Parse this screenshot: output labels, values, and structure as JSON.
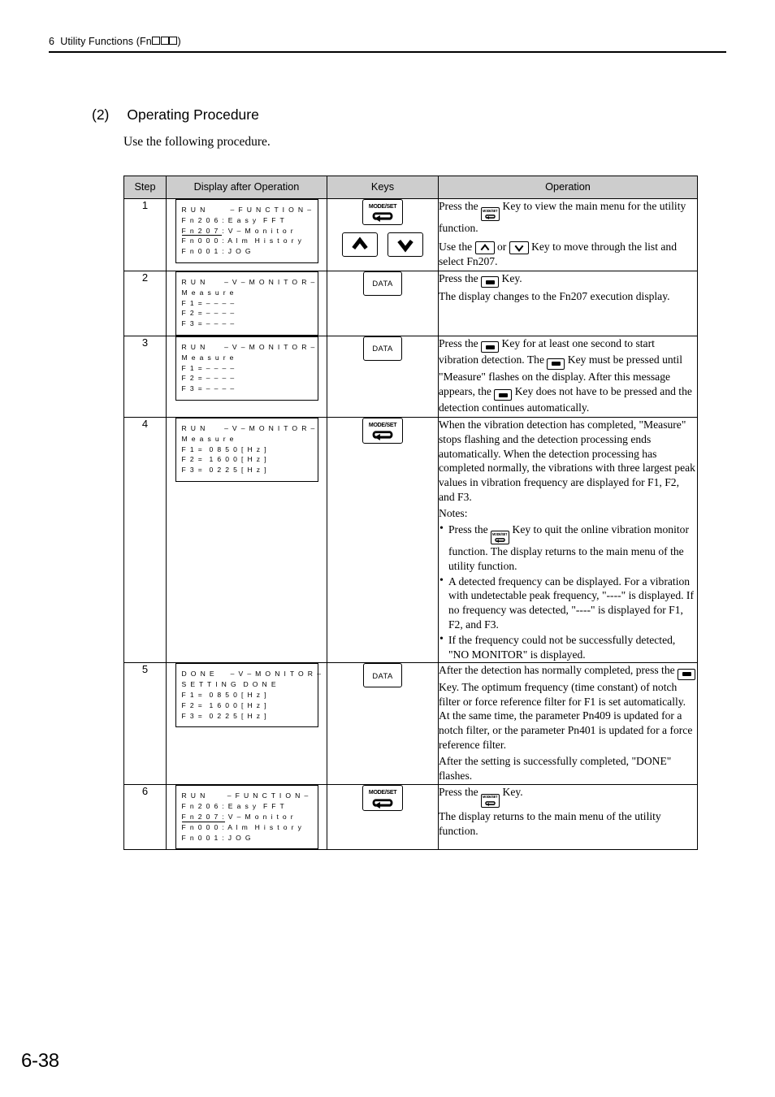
{
  "header": {
    "chapter_number": "6",
    "chapter_title_prefix": "Utility Functions (Fn",
    "chapter_title_suffix": ")",
    "placeholder_box_count": 3
  },
  "section": {
    "number": "(2)",
    "title": "Operating Procedure",
    "intro": "Use the following procedure."
  },
  "table": {
    "headers": {
      "step": "Step",
      "display": "Display after Operation",
      "keys": "Keys",
      "operation": "Operation"
    },
    "rows": [
      {
        "step": "1",
        "display_lines": [
          "R U N        – F U N C T I O N –",
          "F n 2 0 6 : E a s y  F F T",
          "F n 2 0 7 : V – M o n i t o r",
          "F n 0 0 0 : A l m  H i s t o r y",
          "F n 0 0 1 : J O G"
        ],
        "underlined_line_index": 2,
        "underlined_text": "F n 2 0 7 ",
        "keys": [
          "modeset",
          "up",
          "down"
        ],
        "operation_paragraphs": [
          {
            "parts": [
              {
                "type": "text",
                "value": "Press the "
              },
              {
                "type": "icon",
                "value": "modeset-key-icon"
              },
              {
                "type": "text",
                "value": " Key to view the main menu for the utility function."
              }
            ]
          },
          {
            "parts": [
              {
                "type": "text",
                "value": "Use the "
              },
              {
                "type": "icon",
                "value": "up-arrow-key-icon"
              },
              {
                "type": "text",
                "value": " or "
              },
              {
                "type": "icon",
                "value": "down-arrow-key-icon"
              },
              {
                "type": "text",
                "value": " Key to move through the list and select Fn207."
              }
            ]
          }
        ]
      },
      {
        "step": "2",
        "display_lines": [
          "R U N      – V – M O N I T O R –",
          "M e a s u r e",
          "F 1 = – – – –",
          "F 2 = – – – –",
          "F 3 = – – – –"
        ],
        "keys": [
          "data"
        ],
        "operation_paragraphs": [
          {
            "parts": [
              {
                "type": "text",
                "value": "Press the "
              },
              {
                "type": "icon",
                "value": "data-key-icon"
              },
              {
                "type": "text",
                "value": " Key."
              }
            ]
          },
          {
            "parts": [
              {
                "type": "text",
                "value": "The display changes to the Fn207 execution display."
              }
            ]
          }
        ]
      },
      {
        "step": "3",
        "display_lines": [
          "R U N      – V – M O N I T O R –",
          "M e a s u r e",
          "F 1 = – – – –",
          "F 2 = – – – –",
          "F 3 = – – – –"
        ],
        "keys": [
          "data"
        ],
        "operation_paragraphs": [
          {
            "parts": [
              {
                "type": "text",
                "value": "Press the "
              },
              {
                "type": "icon",
                "value": "data-key-icon"
              },
              {
                "type": "text",
                "value": " Key for at least one second to start vibration detection. The "
              },
              {
                "type": "icon",
                "value": "data-key-icon"
              },
              {
                "type": "text",
                "value": " Key must be pressed until \"Measure\" flashes on the display. After this message appears, the "
              },
              {
                "type": "icon",
                "value": "data-key-icon"
              },
              {
                "type": "text",
                "value": " Key does not have to be pressed and the detection continues automatically."
              }
            ]
          }
        ]
      },
      {
        "step": "4",
        "display_lines": [
          "R U N      – V – M O N I T O R –",
          "M e a s u r e",
          "F 1 =  0 8 5 0 [ H z ]",
          "F 2 =  1 6 0 0 [ H z ]",
          "F 3 =  0 2 2 5 [ H z ]"
        ],
        "keys": [
          "modeset"
        ],
        "operation_paragraphs": [
          {
            "parts": [
              {
                "type": "text",
                "value": "When the vibration detection has completed, \"Measure\" stops flashing and the detection processing ends automatically. When the detection processing has completed normally, the vibrations with three largest peak values in vibration frequency are displayed for F1, F2, and F3."
              }
            ]
          },
          {
            "parts": [
              {
                "type": "text",
                "value": "Notes:"
              }
            ]
          }
        ],
        "notes": [
          {
            "parts": [
              {
                "type": "text",
                "value": "Press the "
              },
              {
                "type": "icon",
                "value": "modeset-key-icon"
              },
              {
                "type": "text",
                "value": " Key to quit the online vibration monitor function. The display returns to the main menu of the utility function."
              }
            ]
          },
          {
            "parts": [
              {
                "type": "text",
                "value": "A detected frequency can be displayed. For a vibration with undetectable peak frequency, \"----\" is displayed. If no frequency was detected, \"----\" is displayed for F1, F2, and F3."
              }
            ]
          },
          {
            "parts": [
              {
                "type": "text",
                "value": "If the frequency could not be successfully detected, \"NO MONITOR\" is displayed."
              }
            ]
          }
        ]
      },
      {
        "step": "5",
        "display_lines": [
          "D O N E     – V – M O N I T O R –",
          "S E T T I N G  D O N E",
          "F 1 =  0 8 5 0 [ H z ]",
          "F 2 =  1 6 0 0 [ H z ]",
          "F 3 =  0 2 2 5 [ H z ]"
        ],
        "keys": [
          "data"
        ],
        "operation_paragraphs": [
          {
            "parts": [
              {
                "type": "text",
                "value": "After the detection has normally completed, press the "
              },
              {
                "type": "icon",
                "value": "data-key-icon"
              },
              {
                "type": "text",
                "value": " Key. The optimum frequency (time constant) of notch filter or force reference filter for F1 is set automatically. At the same time, the parameter Pn409 is updated for a notch filter, or the parameter Pn401 is updated for a force reference filter."
              }
            ]
          },
          {
            "parts": [
              {
                "type": "text",
                "value": "After the setting is successfully completed, \"DONE\" flashes."
              }
            ]
          }
        ]
      },
      {
        "step": "6",
        "display_lines": [
          "R U N       – F U N C T I O N –",
          "F n 2 0 6 : E a s y  F F T",
          "F n 2 0 7 : V – M o n i t o r",
          "F n 0 0 0 : A l m  H i s t o r y",
          "F n 0 0 1 : J O G"
        ],
        "underlined_line_index": 2,
        "underlined_text": "F n 2 0 7 :",
        "keys": [
          "modeset"
        ],
        "operation_paragraphs": [
          {
            "parts": [
              {
                "type": "text",
                "value": "Press the "
              },
              {
                "type": "icon",
                "value": "modeset-key-icon"
              },
              {
                "type": "text",
                "value": " Key."
              }
            ]
          },
          {
            "parts": [
              {
                "type": "text",
                "value": "The display returns to the main menu of the utility function."
              }
            ]
          }
        ]
      }
    ]
  },
  "keys_legend": {
    "modeset_label": "MODE/SET",
    "data_label": "DATA",
    "up_label": "up-arrow",
    "down_label": "down-arrow"
  },
  "footer": {
    "page_number": "6-38"
  }
}
